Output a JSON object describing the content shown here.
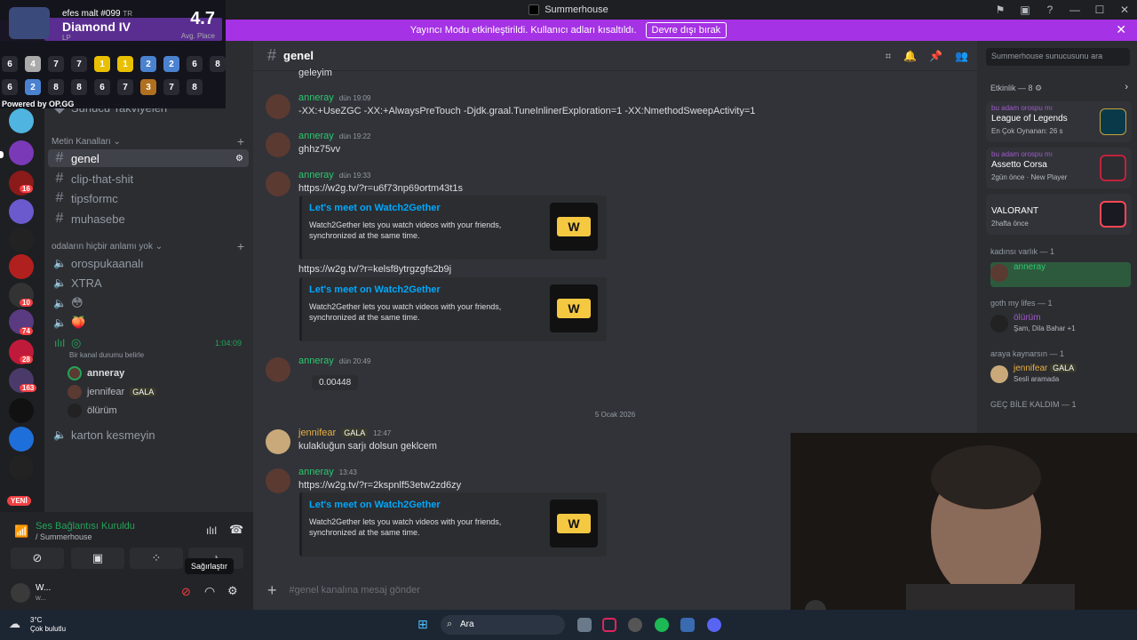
{
  "window": {
    "title": "Summerhouse"
  },
  "banner": {
    "text": "Yayıncı Modu etkinleştirildi. Kullanıcı adları kısaltıldı.",
    "button": "Devre dışı bırak",
    "bg_color": "#a532e4"
  },
  "opgg": {
    "summoner": "efes malt #099",
    "region": "TR",
    "rank": "Diamond IV",
    "lp": "LP",
    "avg_place": "4.7",
    "avg_label": "Avg. Place",
    "powered_by": "Powered by OP.GG",
    "placements_row1": [
      "6",
      "4",
      "7",
      "7",
      "1",
      "1",
      "2",
      "2",
      "6",
      "8"
    ],
    "placements_row2": [
      "6",
      "2",
      "8",
      "8",
      "6",
      "7",
      "3",
      "7",
      "8"
    ]
  },
  "sidebar": {
    "server_name": "Summerhouse",
    "boosts": "Sunucu Takviyeleri",
    "text_category": "Metin Kanalları",
    "text_channels": [
      "genel",
      "clip-that-shit",
      "tipsformc",
      "muhasebe"
    ],
    "voice_category": "odaların hiçbir anlamı yok",
    "voice_channels": [
      "orospukaanalı",
      "XTRA",
      "😳",
      "🍑"
    ],
    "active_channel_timer": "1:04:09",
    "active_channel_status": "Bir kanal durumu belirle",
    "voice_users": [
      {
        "name": "anneray",
        "badge": ""
      },
      {
        "name": "jennifear",
        "badge": "GALA"
      },
      {
        "name": "ölürüm",
        "badge": ""
      }
    ],
    "last_channel": "karton kesmeyin"
  },
  "voice_panel": {
    "status": "Ses Bağlantısı Kuruldu",
    "server": "/ Summerhouse",
    "tooltip": "Sağırlaştır",
    "user_initial": "W...",
    "user_sub": "w..."
  },
  "chat": {
    "channel": "genel",
    "top_partial": "geleyim",
    "messages": [
      {
        "author": "anneray",
        "time": "dün 19:09",
        "text": "-XX:+UseZGC -XX:+AlwaysPreTouch -Djdk.graal.TuneInlinerExploration=1 -XX:NmethodSweepActivity=1"
      },
      {
        "author": "anneray",
        "time": "dün 19:22",
        "text": "ghhz75vv"
      },
      {
        "author": "anneray",
        "time": "dün 19:33",
        "text": "https://w2g.tv/?r=u6f73np69ortm43t1s"
      },
      {
        "author": "",
        "time": "",
        "text": "https://w2g.tv/?r=kelsf8ytrgzgfs2b9j"
      },
      {
        "author": "anneray",
        "time": "dün 20:49",
        "text": "0.00448"
      },
      {
        "author": "jennifear",
        "badge": "GALA",
        "time": "12:47",
        "text": "kulakluğun sarjı dolsun geklcem"
      },
      {
        "author": "anneray",
        "time": "13:43",
        "text": "https://w2g.tv/?r=2kspnlf53etw2zd6zy"
      }
    ],
    "embed": {
      "title": "Let's meet on Watch2Gether",
      "desc": "Watch2Gether lets you watch videos with your friends, synchronized at the same time.",
      "logo": "W"
    },
    "date_divider": "5 Ocak 2026",
    "composer_placeholder": "#genel kanalına mesaj gönder"
  },
  "right": {
    "search_placeholder": "Summerhouse sunucusunu ara",
    "activity_header": "Etkinlik — 8",
    "activities": [
      {
        "who": "bu adam orospu mı",
        "game": "League of Legends",
        "meta": "En Çok Oynanan: 26 s",
        "color": "#c8a23a"
      },
      {
        "who": "bu adam orospu mı",
        "game": "Assetto Corsa",
        "meta": "2gün önce · New Player",
        "color": "#c0233a"
      },
      {
        "who": "",
        "game": "VALORANT",
        "meta": "2hafta önce",
        "color": "#ff4655"
      }
    ],
    "groups": [
      {
        "title": "kadınsı varlık — 1",
        "member": "anneray",
        "status": ""
      },
      {
        "title": "goth my lifes — 1",
        "member": "ölürüm",
        "status": "Şam, Dila Bahar +1"
      },
      {
        "title": "araya kaynarsın — 1",
        "member": "jennifear",
        "badge": "GALA",
        "status": "Sesli aramada"
      },
      {
        "title": "GEÇ BİLE KALDIM — 1",
        "member": "",
        "status": ""
      }
    ]
  },
  "taskbar": {
    "temp": "3°C",
    "weather": "Çok bulutlu",
    "search": "Ara"
  },
  "rail": {
    "new_label": "YENİ"
  }
}
